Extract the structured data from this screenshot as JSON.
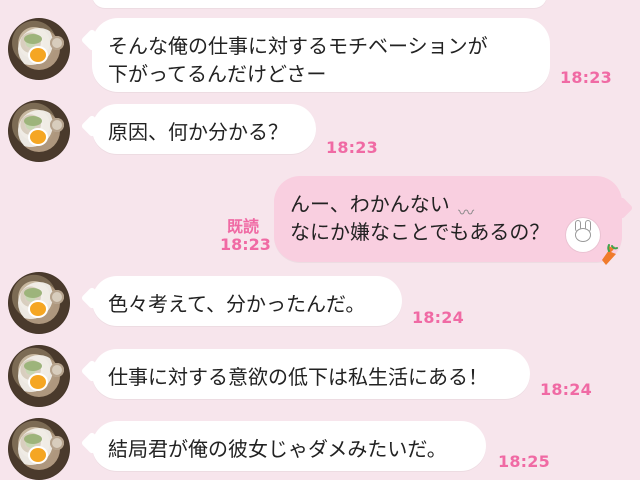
{
  "chat": {
    "messages": [
      {
        "id": "m1",
        "side": "incoming",
        "lines": [
          "そんな俺の仕事に対するモチベーションが",
          "下がってるんだけどさー"
        ],
        "time": "18:23"
      },
      {
        "id": "m2",
        "side": "incoming",
        "lines": [
          "原因、何か分かる？"
        ],
        "time": "18:23"
      },
      {
        "id": "m3",
        "side": "outgoing",
        "lines": [
          "んー、わかんない",
          "なにか嫌なことでもあるの？"
        ],
        "read_label": "既読",
        "time": "18:23",
        "emoji_after_line1": "sweat-wave-emoji",
        "sticker_after_line2": "rabbit-face-emoji",
        "extra_icon": "carrot-icon"
      },
      {
        "id": "m4",
        "side": "incoming",
        "lines": [
          "色々考えて、分かったんだ。"
        ],
        "time": "18:24"
      },
      {
        "id": "m5",
        "side": "incoming",
        "lines": [
          "仕事に対する意欲の低下は私生活にある！"
        ],
        "time": "18:24"
      },
      {
        "id": "m6",
        "side": "incoming",
        "lines": [
          "結局君が俺の彼女じゃダメみたいだ。"
        ],
        "time": "18:25"
      }
    ]
  },
  "colors": {
    "background": "#f7e5ec",
    "incoming_bubble": "#ffffff",
    "outgoing_bubble": "#f9cfe0",
    "accent_time": "#f06aa4"
  }
}
